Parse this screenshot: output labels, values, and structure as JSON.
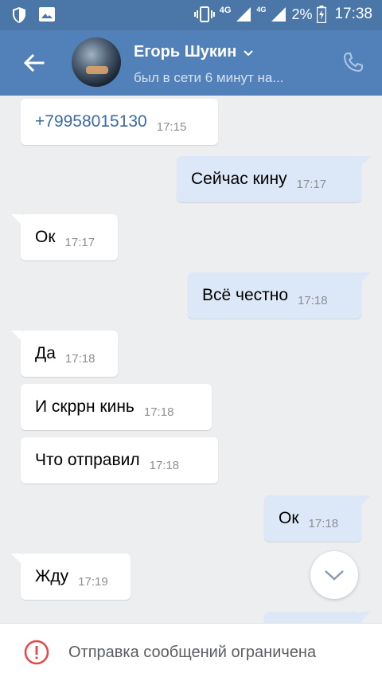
{
  "status_bar": {
    "network_4g_a": "4G",
    "network_4g_b": "4G",
    "battery": "2%",
    "time": "17:38",
    "icons": [
      "shield-icon",
      "image-icon",
      "vibrate-icon",
      "signal-icon",
      "battery-icon"
    ]
  },
  "header": {
    "contact_name": "Егорь Шукин",
    "status": "был в сети 6 минут на...",
    "icons": [
      "back-arrow-icon",
      "chevron-down-icon",
      "phone-icon"
    ],
    "bg_color": "#5181b8"
  },
  "messages": [
    {
      "direction": "in",
      "text": "+79958015130",
      "time": "17:15",
      "is_link": true
    },
    {
      "direction": "out",
      "text": "Сейчас кину",
      "time": "17:17"
    },
    {
      "direction": "in",
      "text": "Ок",
      "time": "17:17"
    },
    {
      "direction": "out",
      "text": "Всё честно",
      "time": "17:18"
    },
    {
      "direction": "in",
      "text": "Да",
      "time": "17:18"
    },
    {
      "direction": "in",
      "text": "И скррн кинь",
      "time": "17:18"
    },
    {
      "direction": "in",
      "text": "Что отправил",
      "time": "17:18"
    },
    {
      "direction": "out",
      "text": "Ок",
      "time": "17:18"
    },
    {
      "direction": "in",
      "text": "Жду",
      "time": "17:19"
    }
  ],
  "footer": {
    "notice": "Отправка сообщений ограничена",
    "icon": "alert-circle-icon",
    "icon_color": "#e64646"
  }
}
